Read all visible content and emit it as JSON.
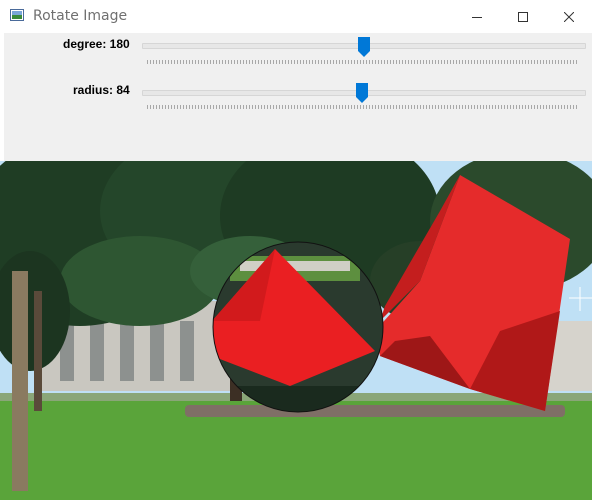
{
  "window": {
    "title": "Rotate Image",
    "icons": [
      "app-icon",
      "minimize-icon",
      "maximize-icon",
      "close-icon"
    ]
  },
  "trackbars": [
    {
      "label": "degree: 180",
      "name": "degree",
      "value": 180,
      "position_fraction": 0.5
    },
    {
      "label": "radius: 84",
      "name": "radius",
      "value": 84,
      "position_fraction": 0.5
    }
  ],
  "colors": {
    "accent": "#0078d7",
    "panel": "#f0f0f0",
    "sculpture_red": "#e52b2b",
    "grass": "#5aa43a",
    "sky": "#bfe0f5"
  }
}
